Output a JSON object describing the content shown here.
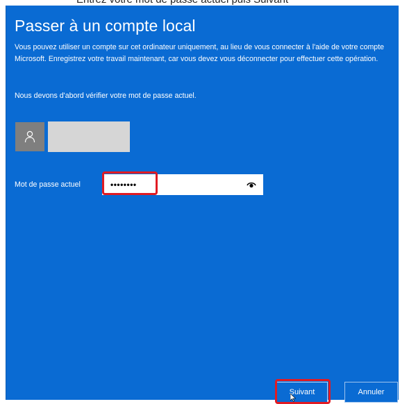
{
  "top_caption": "Entrez votre mot de passe actuel puis Suivant",
  "dialog": {
    "title": "Passer à un compte local",
    "description": "Vous pouvez utiliser un compte sur cet ordinateur uniquement, au lieu de vous connecter à l'aide de votre compte Microsoft. Enregistrez votre travail maintenant, car vous devez vous déconnecter pour effectuer cette opération.",
    "verify_text": "Nous devons d'abord vérifier votre mot de passe actuel.",
    "user": {
      "avatar_icon": "user-silhouette-icon"
    },
    "password": {
      "label": "Mot de passe actuel",
      "value": "••••••••",
      "reveal_icon": "eye-icon"
    },
    "buttons": {
      "next": "Suivant",
      "cancel": "Annuler"
    }
  },
  "colors": {
    "dialog_background": "#0a6bd3",
    "highlight": "#e11b23"
  }
}
